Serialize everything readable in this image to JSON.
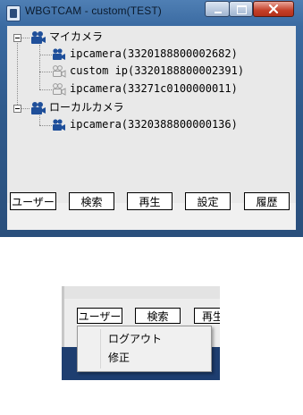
{
  "window": {
    "title": "WBGTCAM - custom(TEST)",
    "controls": [
      "minimize",
      "maximize",
      "close"
    ]
  },
  "tree": {
    "groups": [
      {
        "label": "マイカメラ",
        "icon": "camera-group-icon",
        "children": [
          {
            "label": "ipcamera(3320188800002682)",
            "icon": "camera-online-icon"
          },
          {
            "label": "custom ip(3320188800002391)",
            "icon": "camera-offline-icon"
          },
          {
            "label": "ipcamera(33271c0100000011)",
            "icon": "camera-offline-icon"
          }
        ]
      },
      {
        "label": "ローカルカメラ",
        "icon": "camera-group-icon",
        "children": [
          {
            "label": "ipcamera(3320388800000136)",
            "icon": "camera-online-icon"
          }
        ]
      }
    ]
  },
  "buttons": {
    "user": "ユーザー",
    "search": "検索",
    "play": "再生",
    "settings": "設定",
    "history": "履歴"
  },
  "inset": {
    "buttons": {
      "user": "ユーザー",
      "search": "検索",
      "play_partial": "再生"
    },
    "menu": {
      "items": [
        "ログアウト",
        "修正"
      ]
    }
  },
  "colors": {
    "titlebar": "#3a6aa1",
    "close_button": "#c43f28",
    "camera_blue": "#1f4f9a",
    "tree_background": "#e9e9e9"
  }
}
